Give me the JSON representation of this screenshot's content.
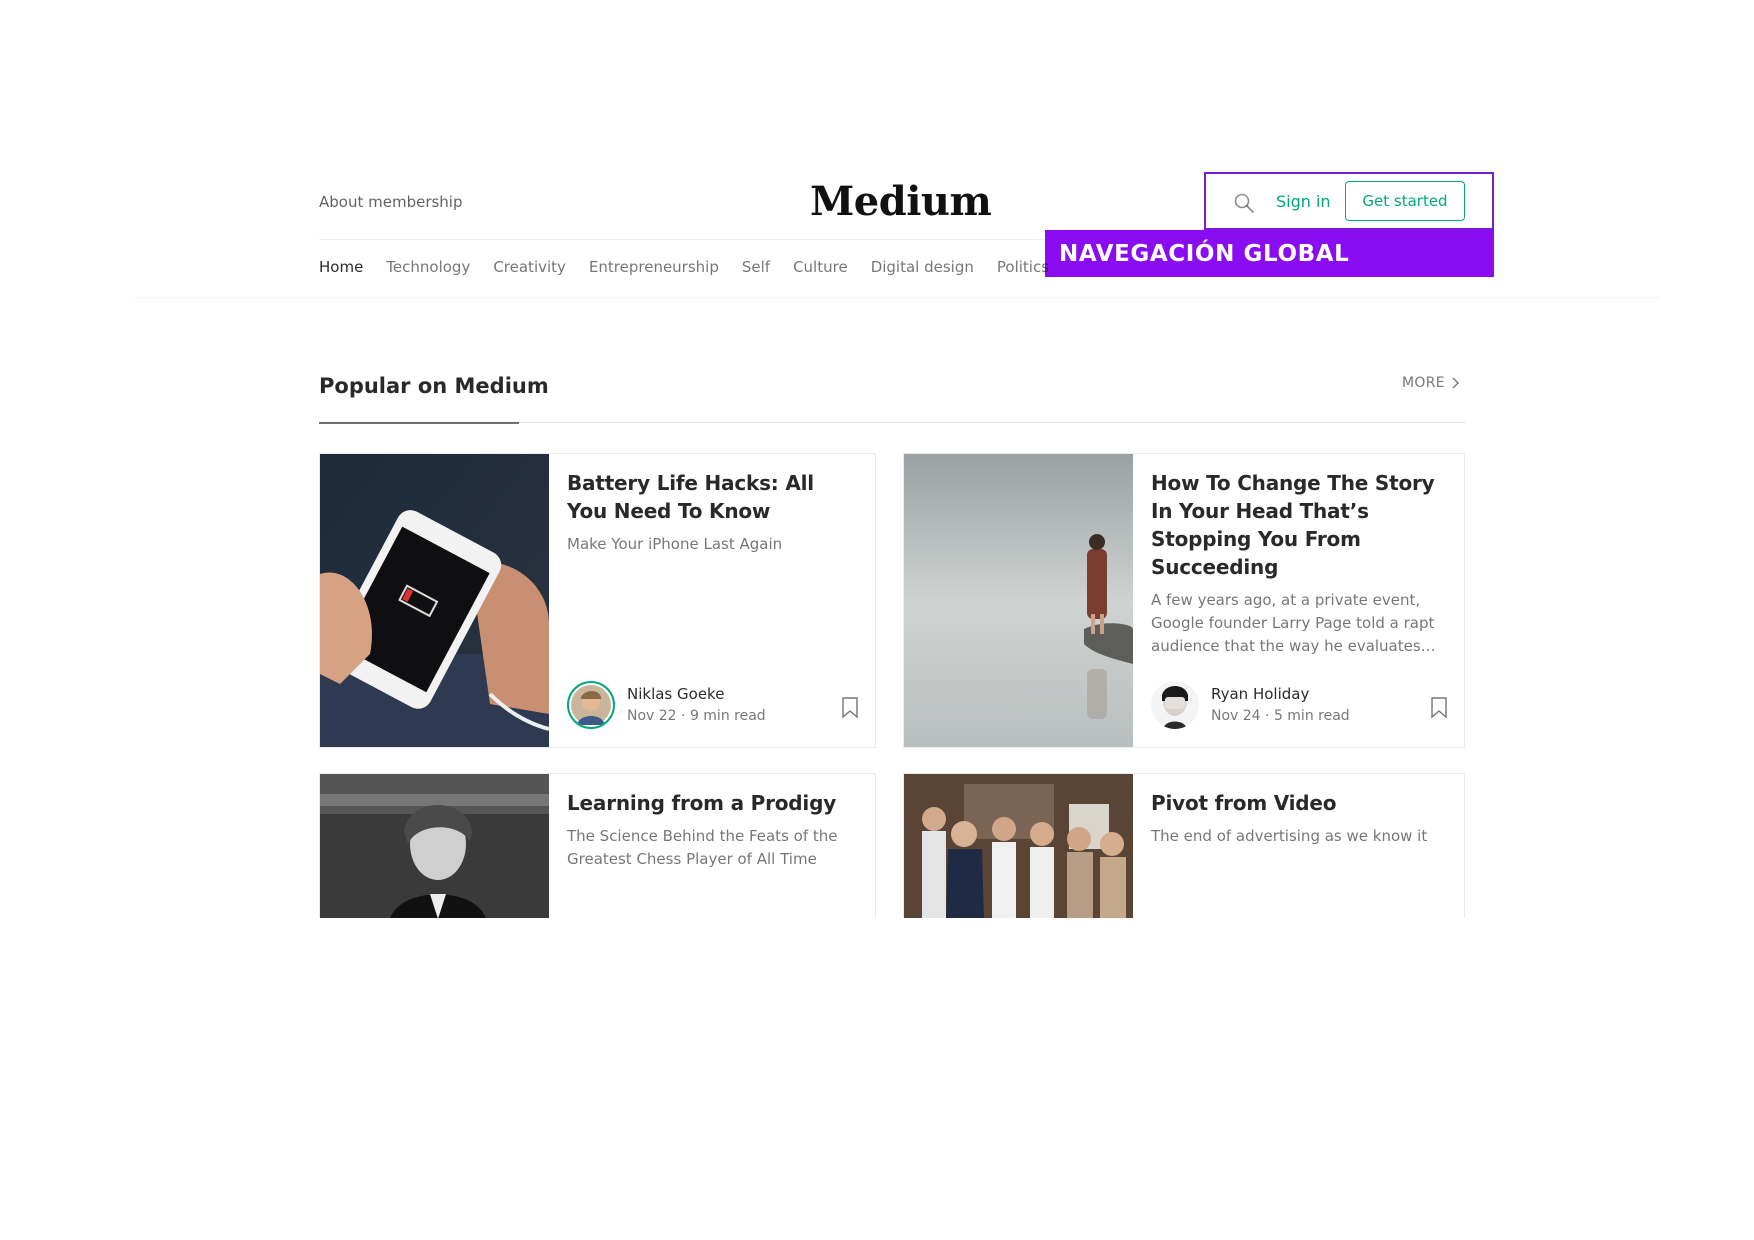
{
  "header": {
    "about_label": "About membership",
    "logo": "Medium",
    "signin_label": "Sign in",
    "get_started_label": "Get started",
    "accent_color": "#03a87c"
  },
  "annotation": {
    "label": "NAVEGACIÓN GLOBAL",
    "color": "#8a0cf0"
  },
  "nav": {
    "items": [
      "Home",
      "Technology",
      "Creativity",
      "Entrepreneurship",
      "Self",
      "Culture",
      "Digital design",
      "Politics"
    ],
    "active": "Home"
  },
  "section": {
    "title": "Popular on Medium",
    "more_label": "MORE"
  },
  "cards": [
    {
      "title": "Battery Life Hacks: All You Need To Know",
      "subtitle": "Make Your iPhone Last Again",
      "author": "Niklas Goeke",
      "meta": "Nov 22 · 9 min read",
      "image": "hand holding phone with low battery"
    },
    {
      "title": "How To Change The Story In Your Head That’s Stopping You From Succeeding",
      "subtitle": "A few years ago, at a private event, Google founder Larry Page told a rapt audience that the way he evaluates…",
      "author": "Ryan Holiday",
      "meta": "Nov 24 · 5 min read",
      "image": "woman standing at water's edge"
    },
    {
      "title": "Learning from a Prodigy",
      "subtitle": "The Science Behind the Feats of the Greatest Chess Player of All Time",
      "image": "black and white portrait of young man"
    },
    {
      "title": "Pivot from Video",
      "subtitle": "The end of advertising as we know it",
      "image": "group of office workers"
    }
  ]
}
